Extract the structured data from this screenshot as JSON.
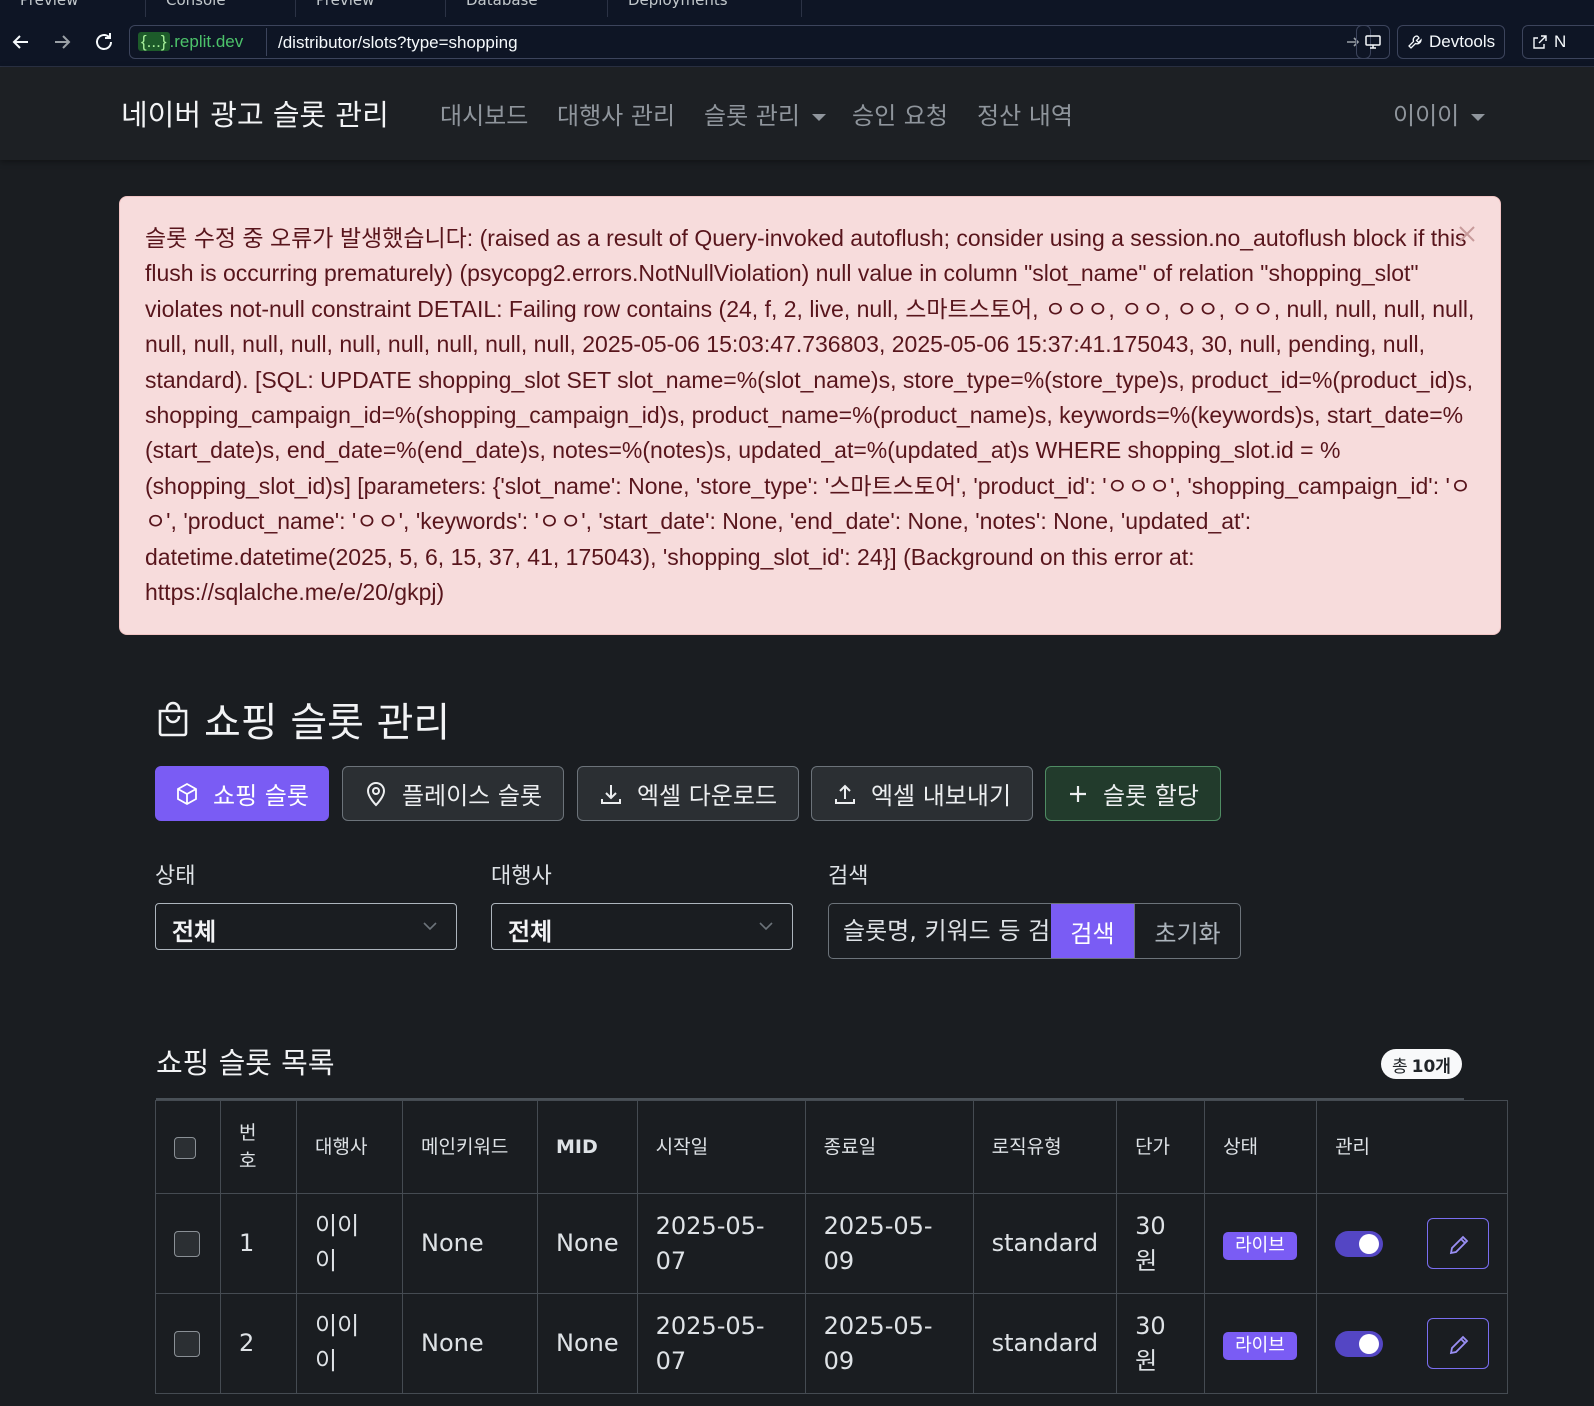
{
  "browser": {
    "tabs": [
      "Preview",
      "Console",
      "Preview",
      "Database",
      "Deployments"
    ],
    "url_host_braces": "{...}",
    "url_host_domain": ".replit.dev",
    "url_path": "/distributor/slots?type=shopping",
    "devtools_label": "Devtools",
    "newtab_label": "N"
  },
  "navbar": {
    "brand": "네이버 광고 슬롯 관리",
    "links": [
      "대시보드",
      "대행사 관리",
      "슬롯 관리",
      "승인 요청",
      "정산 내역"
    ],
    "user": "이이이"
  },
  "alert": {
    "text": "슬롯 수정 중 오류가 발생했습니다: (raised as a result of Query-invoked autoflush; consider using a session.no_autoflush block if this flush is occurring prematurely) (psycopg2.errors.NotNullViolation) null value in column \"slot_name\" of relation \"shopping_slot\" violates not-null constraint DETAIL: Failing row contains (24, f, 2, live, null, 스마트스토어, ㅇㅇㅇ, ㅇㅇ, ㅇㅇ, ㅇㅇ, null, null, null, null, null, null, null, null, null, null, null, null, null, 2025-05-06 15:03:47.736803, 2025-05-06 15:37:41.175043, 30, null, pending, null, standard). [SQL: UPDATE shopping_slot SET slot_name=%(slot_name)s, store_type=%(store_type)s, product_id=%(product_id)s, shopping_campaign_id=%(shopping_campaign_id)s, product_name=%(product_name)s, keywords=%(keywords)s, start_date=%(start_date)s, end_date=%(end_date)s, notes=%(notes)s, updated_at=%(updated_at)s WHERE shopping_slot.id = %(shopping_slot_id)s] [parameters: {'slot_name': None, 'store_type': '스마트스토어', 'product_id': 'ㅇㅇㅇ', 'shopping_campaign_id': 'ㅇㅇ', 'product_name': 'ㅇㅇ', 'keywords': 'ㅇㅇ', 'start_date': None, 'end_date': None, 'notes': None, 'updated_at': datetime.datetime(2025, 5, 6, 15, 37, 41, 175043), 'shopping_slot_id': 24}] (Background on this error at: https://sqlalche.me/e/20/gkpj)"
  },
  "page": {
    "title": "쇼핑 슬롯 관리",
    "buttons": {
      "shopping": "쇼핑 슬롯",
      "place": "플레이스 슬롯",
      "excel_download": "엑셀 다운로드",
      "excel_export": "엑셀 내보내기",
      "assign": "슬롯 할당"
    },
    "filters": {
      "status_label": "상태",
      "status_value": "전체",
      "agency_label": "대행사",
      "agency_value": "전체",
      "search_label": "검색",
      "search_placeholder": "슬롯명, 키워드 등 검색",
      "search_button": "검색",
      "reset_button": "초기화"
    },
    "list_title": "쇼핑 슬롯 목록",
    "count_prefix": "총",
    "count_value": "10개"
  },
  "table": {
    "headers": [
      "번호",
      "대행사",
      "메인키워드",
      "MID",
      "시작일",
      "종료일",
      "로직유형",
      "단가",
      "상태",
      "관리"
    ],
    "rows": [
      {
        "no": "1",
        "agency": "이이이",
        "keyword": "None",
        "mid": "None",
        "start": "2025-05-07",
        "end": "2025-05-09",
        "logic": "standard",
        "price": "30원",
        "status": "라이브"
      },
      {
        "no": "2",
        "agency": "이이이",
        "keyword": "None",
        "mid": "None",
        "start": "2025-05-07",
        "end": "2025-05-09",
        "logic": "standard",
        "price": "30원",
        "status": "라이브"
      }
    ]
  },
  "colors": {
    "primary": "#7a5cf4",
    "alert_bg": "#f7dcdc",
    "alert_text": "#58151c",
    "bg": "#1a1d21"
  }
}
